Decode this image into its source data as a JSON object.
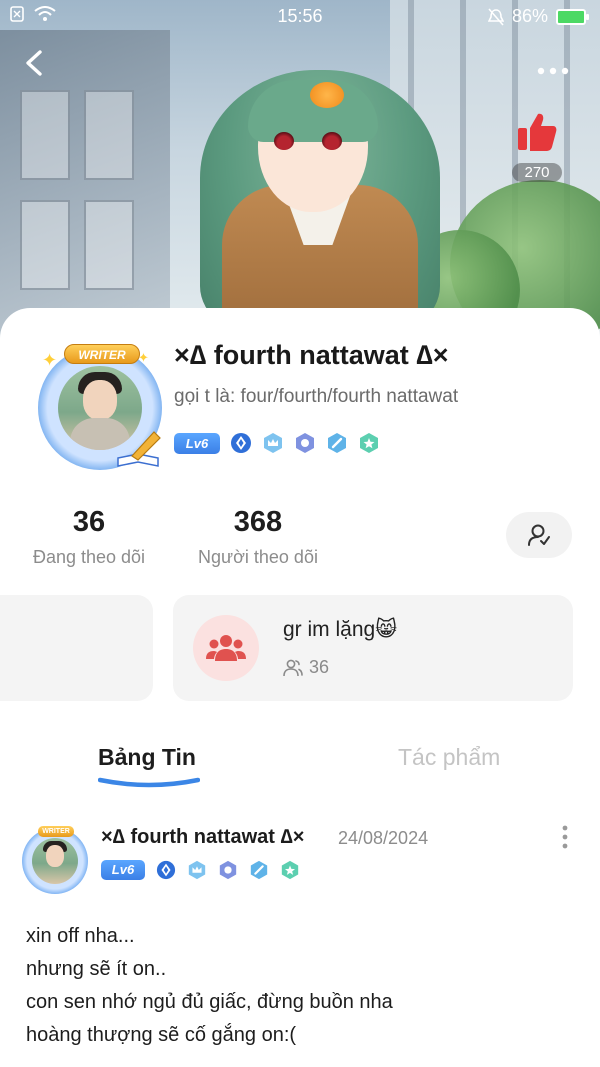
{
  "status_bar": {
    "time": "15:56",
    "battery": "86%"
  },
  "header": {
    "likes": "270"
  },
  "profile": {
    "name": "×∆ fourth nattawat ∆×",
    "alias": "gọi t là: four/fourth/fourth nattawat",
    "badge_writer": "WRITER",
    "level": "Lv6"
  },
  "stats": {
    "following_count": "36",
    "following_label": "Đang theo dõi",
    "followers_count": "368",
    "followers_label": "Người theo dõi"
  },
  "group": {
    "title": "gr im lặng😸",
    "members": "36"
  },
  "tabs": [
    {
      "label": "Bảng Tin",
      "active": true
    },
    {
      "label": "Tác phẩm",
      "active": false
    }
  ],
  "post": {
    "author": "×∆ fourth nattawat ∆×",
    "date": "24/08/2024",
    "level": "Lv6",
    "lines": [
      "xin off nha...",
      "nhưng sẽ ít on..",
      "con sen nhớ ngủ đủ giấc, đừng buồn nha",
      "hoàng thượng sẽ cố gắng on:("
    ]
  },
  "colors": {
    "accent_blue": "#3b86e6",
    "like_red": "#e5383b",
    "group_icon_red": "#e0524f"
  }
}
